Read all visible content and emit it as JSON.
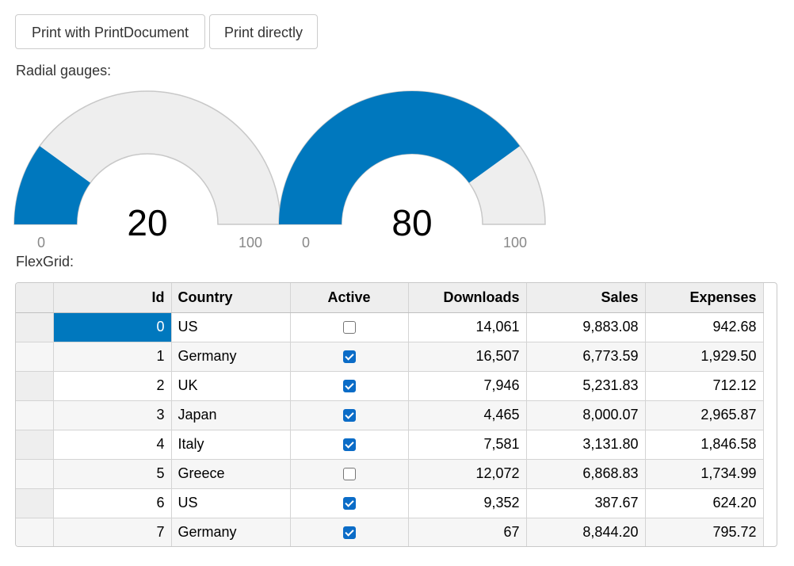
{
  "toolbar": {
    "print_document_label": "Print with PrintDocument",
    "print_directly_label": "Print directly"
  },
  "gauges": {
    "section_label": "Radial gauges:",
    "items": [
      {
        "value": 20,
        "display": "20",
        "min": "0",
        "max": "100"
      },
      {
        "value": 80,
        "display": "80",
        "min": "0",
        "max": "100"
      }
    ],
    "colors": {
      "fill": "#0078be",
      "track": "#eeeeee",
      "track_border": "#c8c8c8"
    }
  },
  "grid": {
    "section_label": "FlexGrid:",
    "columns": [
      "Id",
      "Country",
      "Active",
      "Downloads",
      "Sales",
      "Expenses"
    ],
    "rows": [
      {
        "id": "0",
        "country": "US",
        "active": false,
        "downloads": "14,061",
        "sales": "9,883.08",
        "expenses": "942.68"
      },
      {
        "id": "1",
        "country": "Germany",
        "active": true,
        "downloads": "16,507",
        "sales": "6,773.59",
        "expenses": "1,929.50"
      },
      {
        "id": "2",
        "country": "UK",
        "active": true,
        "downloads": "7,946",
        "sales": "5,231.83",
        "expenses": "712.12"
      },
      {
        "id": "3",
        "country": "Japan",
        "active": true,
        "downloads": "4,465",
        "sales": "8,000.07",
        "expenses": "2,965.87"
      },
      {
        "id": "4",
        "country": "Italy",
        "active": true,
        "downloads": "7,581",
        "sales": "3,131.80",
        "expenses": "1,846.58"
      },
      {
        "id": "5",
        "country": "Greece",
        "active": false,
        "downloads": "12,072",
        "sales": "6,868.83",
        "expenses": "1,734.99"
      },
      {
        "id": "6",
        "country": "US",
        "active": true,
        "downloads": "9,352",
        "sales": "387.67",
        "expenses": "624.20"
      },
      {
        "id": "7",
        "country": "Germany",
        "active": true,
        "downloads": "67",
        "sales": "8,844.20",
        "expenses": "795.72"
      }
    ],
    "selection_color": "#0078be"
  }
}
